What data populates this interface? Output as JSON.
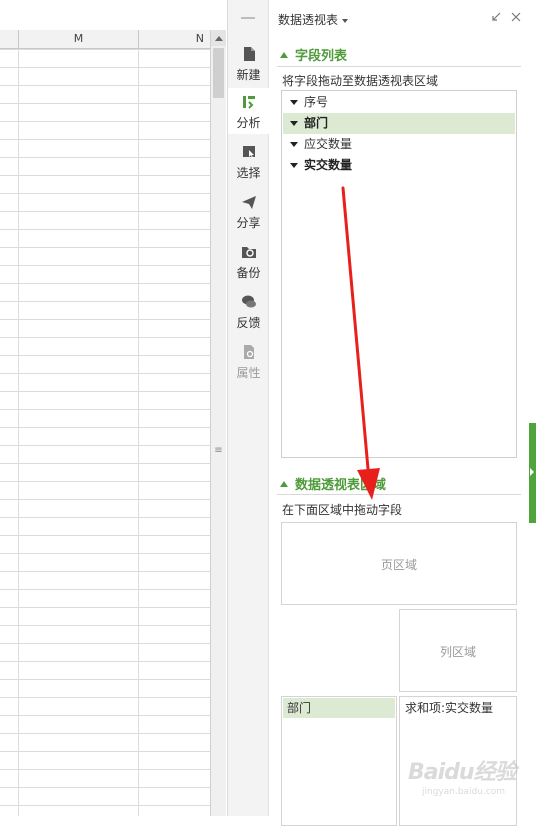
{
  "sheet": {
    "columns": [
      "M",
      "N"
    ]
  },
  "toolstrip": {
    "items": [
      {
        "label": "新建",
        "icon": "new-document-icon"
      },
      {
        "label": "分析",
        "icon": "analyze-icon"
      },
      {
        "label": "选择",
        "icon": "select-icon"
      },
      {
        "label": "分享",
        "icon": "share-icon"
      },
      {
        "label": "备份",
        "icon": "backup-icon"
      },
      {
        "label": "反馈",
        "icon": "feedback-icon"
      },
      {
        "label": "属性",
        "icon": "properties-icon"
      }
    ]
  },
  "panel": {
    "title": "数据透视表",
    "field_list": {
      "heading": "字段列表",
      "hint": "将字段拖动至数据透视表区域",
      "fields": [
        {
          "name": "序号",
          "selected": false,
          "bold": false
        },
        {
          "name": "部门",
          "selected": true,
          "bold": true
        },
        {
          "name": "应交数量",
          "selected": false,
          "bold": false
        },
        {
          "name": "实交数量",
          "selected": false,
          "bold": true
        }
      ]
    },
    "areas": {
      "heading": "数据透视表区域",
      "hint": "在下面区域中拖动字段",
      "page_area": "页区域",
      "column_area": "列区域",
      "row_area_field": "部门",
      "value_area_field": "求和项:实交数量"
    }
  },
  "watermark": {
    "brand": "Baidu经验",
    "url": "jingyan.baidu.com"
  },
  "colors": {
    "accent_green": "#4f9a3a",
    "selected_row_bg": "#dcead3",
    "annotation_red": "#e8201c"
  }
}
